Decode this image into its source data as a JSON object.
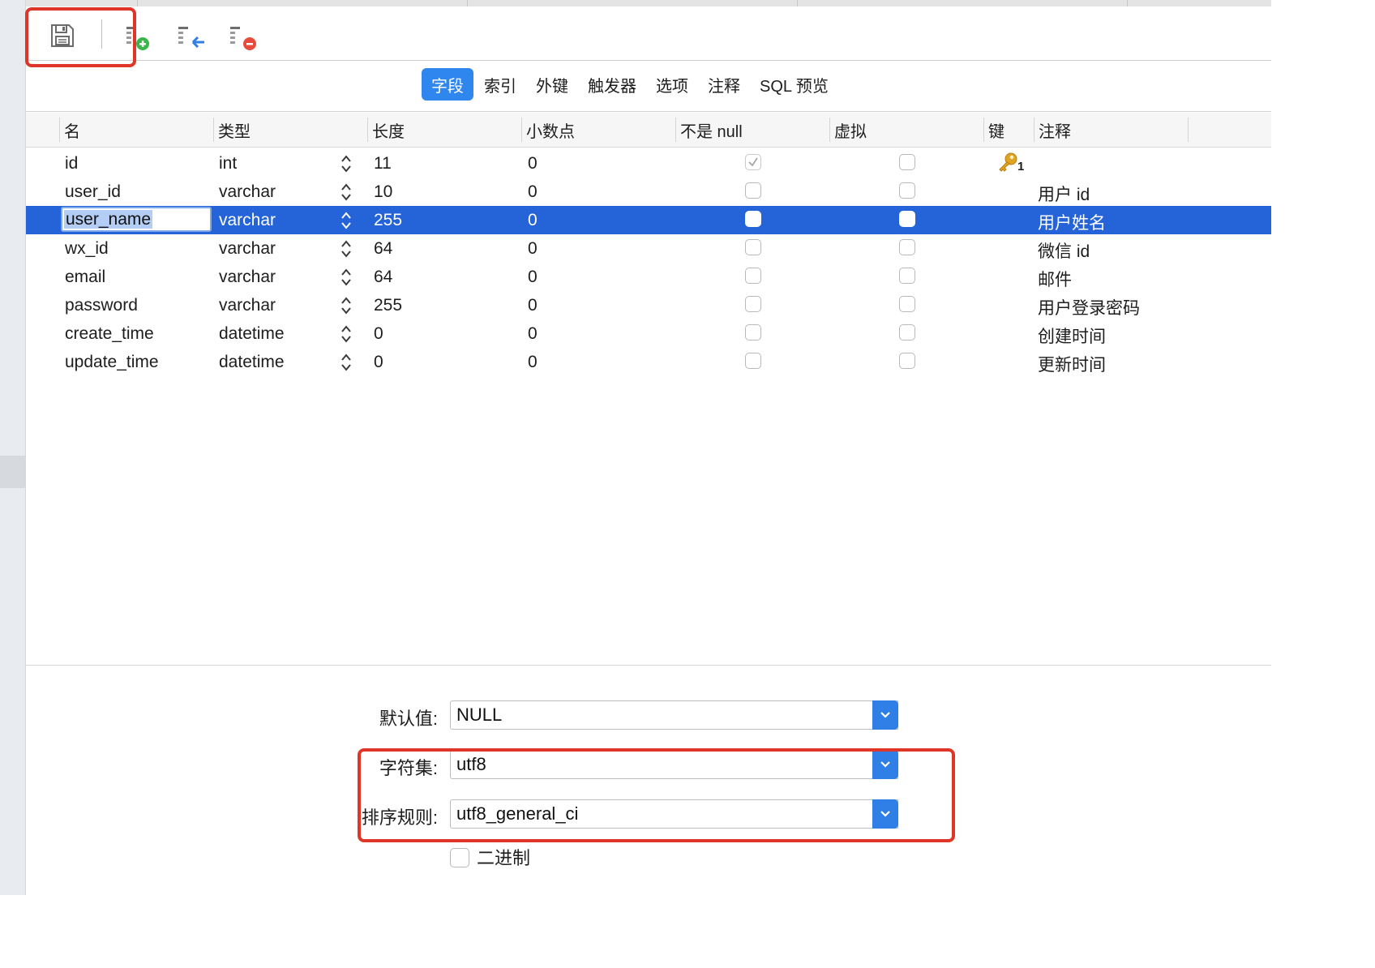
{
  "toolbar": {
    "buttons": [
      {
        "name": "save",
        "icon": "save-icon"
      },
      {
        "name": "add-field",
        "icon": "add-field-icon"
      },
      {
        "name": "insert-field",
        "icon": "insert-field-icon"
      },
      {
        "name": "delete-field",
        "icon": "delete-field-icon"
      }
    ]
  },
  "tabs": [
    {
      "label": "字段",
      "active": true
    },
    {
      "label": "索引",
      "active": false
    },
    {
      "label": "外键",
      "active": false
    },
    {
      "label": "触发器",
      "active": false
    },
    {
      "label": "选项",
      "active": false
    },
    {
      "label": "注释",
      "active": false
    },
    {
      "label": "SQL 预览",
      "active": false
    }
  ],
  "grid": {
    "columns": [
      "名",
      "类型",
      "长度",
      "小数点",
      "不是 null",
      "虚拟",
      "键",
      "注释"
    ],
    "rows": [
      {
        "name": "id",
        "type": "int",
        "length": "11",
        "decimals": "0",
        "not_null": true,
        "virtual": false,
        "key": "1",
        "comment": ""
      },
      {
        "name": "user_id",
        "type": "varchar",
        "length": "10",
        "decimals": "0",
        "not_null": false,
        "virtual": false,
        "key": "",
        "comment": "用户 id"
      },
      {
        "name": "user_name",
        "type": "varchar",
        "length": "255",
        "decimals": "0",
        "not_null": false,
        "virtual": false,
        "key": "",
        "comment": "用户姓名",
        "selected": true
      },
      {
        "name": "wx_id",
        "type": "varchar",
        "length": "64",
        "decimals": "0",
        "not_null": false,
        "virtual": false,
        "key": "",
        "comment": "微信 id"
      },
      {
        "name": "email",
        "type": "varchar",
        "length": "64",
        "decimals": "0",
        "not_null": false,
        "virtual": false,
        "key": "",
        "comment": "邮件"
      },
      {
        "name": "password",
        "type": "varchar",
        "length": "255",
        "decimals": "0",
        "not_null": false,
        "virtual": false,
        "key": "",
        "comment": "用户登录密码"
      },
      {
        "name": "create_time",
        "type": "datetime",
        "length": "0",
        "decimals": "0",
        "not_null": false,
        "virtual": false,
        "key": "",
        "comment": "创建时间"
      },
      {
        "name": "update_time",
        "type": "datetime",
        "length": "0",
        "decimals": "0",
        "not_null": false,
        "virtual": false,
        "key": "",
        "comment": "更新时间"
      }
    ]
  },
  "properties": {
    "default_label": "默认值:",
    "default_value": "NULL",
    "charset_label": "字符集:",
    "charset_value": "utf8",
    "collation_label": "排序规则:",
    "collation_value": "utf8_general_ci",
    "binary_label": "二进制",
    "binary_checked": false
  },
  "colors": {
    "accent": "#2f86ee",
    "selection": "#2463d8",
    "highlight_annotation": "#e0362a"
  }
}
